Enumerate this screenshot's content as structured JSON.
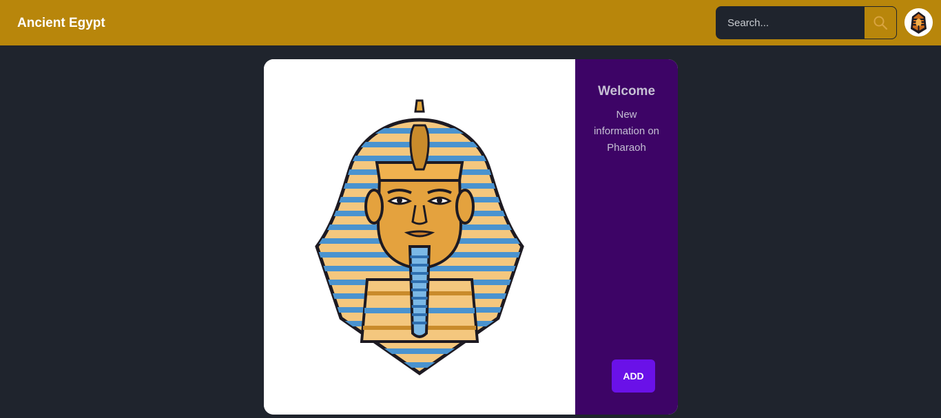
{
  "navbar": {
    "brand": "Ancient Egypt",
    "search": {
      "placeholder": "Search...",
      "value": "",
      "button_icon": "search-icon"
    },
    "avatar_icon": "pharaoh-avatar"
  },
  "card": {
    "image_icon": "pharaoh-mask-illustration",
    "side": {
      "title": "Welcome",
      "text": "New information on Pharaoh",
      "add_label": "ADD"
    }
  },
  "colors": {
    "navbar": "#b8860b",
    "page_background": "#1f242d",
    "side_panel": "#3d0466",
    "add_button": "#6a11e8"
  }
}
